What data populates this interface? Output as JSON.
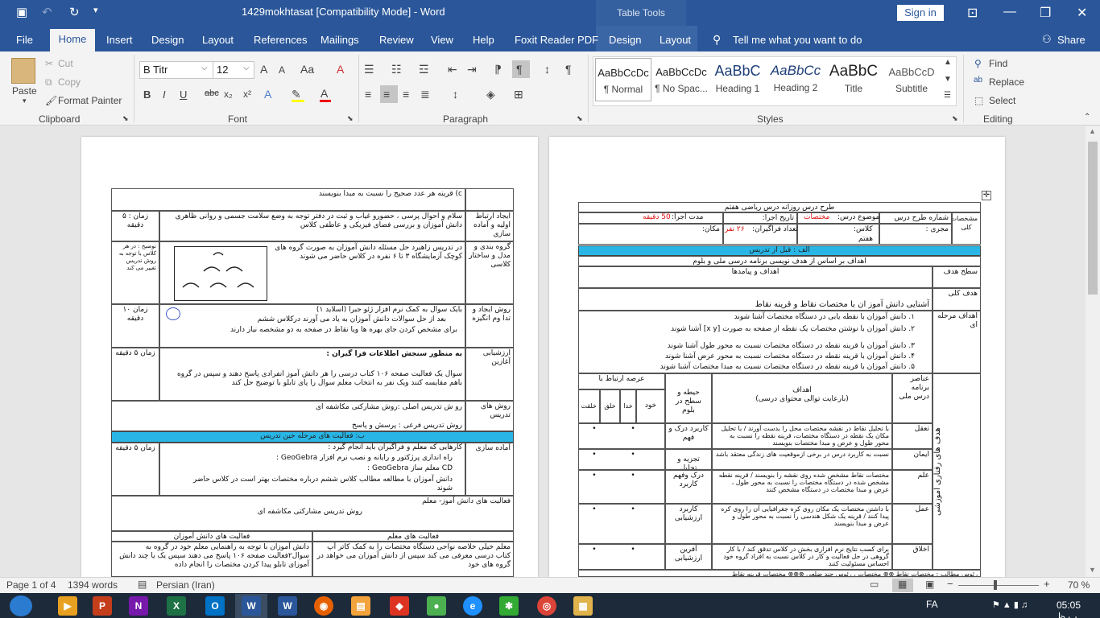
{
  "window": {
    "title": "1429mokhtasat [Compatibility Mode]  -  Word",
    "context_tab_title": "Table Tools",
    "sign_in": "Sign in"
  },
  "tabs": [
    "File",
    "Home",
    "Insert",
    "Design",
    "Layout",
    "References",
    "Mailings",
    "Review",
    "View",
    "Help",
    "Foxit Reader PDF",
    "Design",
    "Layout"
  ],
  "tell_me": "Tell me what you want to do",
  "share": "Share",
  "clipboard": {
    "paste": "Paste",
    "cut": "Cut",
    "copy": "Copy",
    "format_painter": "Format Painter",
    "label": "Clipboard"
  },
  "font": {
    "name": "B Titr",
    "size": "12",
    "label": "Font"
  },
  "paragraph": {
    "label": "Paragraph"
  },
  "styles": {
    "label": "Styles",
    "items": [
      {
        "preview": "AaBbCcDc",
        "name": "¶ Normal"
      },
      {
        "preview": "AaBbCcDc",
        "name": "¶ No Spac..."
      },
      {
        "preview": "AaBbC",
        "name": "Heading 1"
      },
      {
        "preview": "AaBbCc",
        "name": "Heading 2"
      },
      {
        "preview": "AaBbC",
        "name": "Title"
      },
      {
        "preview": "AaBbCcD",
        "name": "Subtitle"
      }
    ]
  },
  "editing": {
    "find": "Find",
    "replace": "Replace",
    "select": "Select",
    "label": "Editing"
  },
  "status": {
    "page": "Page 1 of 4",
    "words": "1394 words",
    "language": "Persian (Iran)",
    "zoom": "70 %"
  },
  "taskbar": {
    "lang": "FA",
    "time": "05:05 ب.ظ"
  },
  "left_page": {
    "r1": "c)   قرینه هر عدد صحیح را نسبت به مبدا بنویسند",
    "r2_h": "ایجاد ارتباط اولیه و آماده سازی",
    "r2_t": "سلام و احوال پرسی ، حضورو غیاب و ثبت در دفتر توجه به  وضع سلامت جسمی و روانی ظاهری دانش آموزان و بررسی فضای فیزیکی و عاطفی کلاس",
    "r2_z": "زمان : ۵ دقیقه",
    "r3_h": "گروه بندی و مدل و ساختار کلاسی",
    "r3_t": "در تدریس زاهبرد حل مسئله دانش آموزان به صورت گروه های کوچک آزمایشگاه ۳ تا ۶ نفره در کلاس حاضر می شوند",
    "r3_z": "توضیح : در هر کلاس با توجه به روش تدریس تغییر می کند",
    "r4_h": "روش ایجاد و تدا وم انگیزه",
    "r4_t1": "بایک سوال به کمک نرم افزار ژئو جبرا (اسلاید ۱)",
    "r4_t2": "بعد از حل سوالات دانش آموزان به یاد می آورند درکلاس ششم",
    "r4_t3": "برای مشخص کردن جای بهره ها ویا نقاط در صفحه به دو مشخصه نیاز دارند",
    "r4_z": "زمان ۱۰ دقیقه",
    "r5_h": "ارزشیابی آغازین",
    "r5_b": "به منظور سنجش اطلاعات فرا گیران :",
    "r5_t": "سوال یک فعالیت صفحه ۱۰۶ کتاب درسی را هر دانش آموز انفرادی پاسخ دهند و سپس در گروه باهم مقایسه کنند ویک نفر به انتخاب معلم سوال را پای تابلو با توضیح حل کند",
    "r5_z": "زمان ۵ دقیقه",
    "r6_h": "روش های تدریس",
    "r6_t1": "رو ش تدریس اصلی :روش مشارکتی مکاشفه ای",
    "r6_t2": "روش تدریس فرعی : پرسش و پاسخ",
    "bar": "ب: فعالیت های مرحله حین تدریس",
    "r7_h": "آماده سازی",
    "r7_t1": "کارهایی که معلم و فراگیران باید انجام گیرد :",
    "r7_t2": "راه اندازی پرژکتور و رایانه و نصب نرم افزار GeoGebra :",
    "r7_t3": "CD معلم ساز GeoGebra :",
    "r7_t4": "دانش آموزان با مطالعه مطالب کلاس ششم درباره مختصات بهتر است در کلاس حاضر شوند",
    "r7_z": "زمان ۵ دقیقه",
    "r8_t1": "فعالیت های دانش آموز- معلم",
    "r8_t2": "روش تدریس مشارکتی مکاشفه ای",
    "h_student": "فعالیت های دانش آموزان",
    "h_teacher": "فعالیت های معلم",
    "c_student": "دانش آموزان با توجه به راهنمایی معلم خود در گروه به سوال۲فعالیت صفحه ۱۰۶ پاسخ می دهند سپس یک یا چند دانش آموزای تابلو پیدا کردن مختصات را انجام داده",
    "c_teacher": "معلم خیلی خلاصه نواحی دستگاه مختصات را به کمک کاتر آپ کتاب درسی معرفی می کند سپس از دانش آموزان می خواهد در گروه های خود"
  },
  "right_page": {
    "title": "طرح درس روزانه  درس ریاضی هفتم",
    "plan_no": "شماره طرح درس",
    "topic": "موضوع درس:",
    "topic_val": "مختصات",
    "date": "تاریخ اجرا:",
    "duration": "مدت اجرا:",
    "duration_val": "50 دقیقه",
    "spec": "مشخصات کلی",
    "executor": "مجری :",
    "class": "کلاس:",
    "class_val": "هفتم",
    "students": "تعداد فراگیران:",
    "students_val": "۲۶ نفر",
    "place": "مکان:",
    "bar_a": "الف : قبل از تدریس",
    "goals_line": "اهداف بر اساس از هدف نویسی برنامه درسی ملی و بلوم",
    "level": "سطح هدف",
    "goals_out": "اهداف و پیامدها",
    "general": "هدف کلی",
    "general_t": "آشنایی دانش آموز ان با مختصات نقاط و قرینه نقاط",
    "stage": "اهداف مرحله ای",
    "g1": "۱.  دانش آموزان با نقطه یابی در دستگاه مختصات آشنا شوند",
    "g2": "۲.  دانش آموزان با نوشتن مختصات یک نقطه از صفحه به صورت [x y] آشنا شوند",
    "g3": "۳.  دانش آموزان با قرینه نقطه در دستگاه مختصات نسبت به محور طول آشنا شوند",
    "g4": "۴.  دانش آموزان با قرینه نقطه در دستگاه مختصات نسبت به محور عرض آشنا شوند",
    "g5": "۵.  دانش آموزان با قرینه نقطه در دستگاه مختصات نسبت به مبدا مختصات  آشنا شوند",
    "elements": "عناصر برنامه درس ملی",
    "objectives": "اهداف",
    "objectives_sub": "(بارعایت توالی محتوای درسی)",
    "bloom": "حیطه و سطح در بلوم",
    "relation": "عرصه ارتباط با",
    "rel_cols": [
      "خود",
      "خدا",
      "خلق",
      "خلقت"
    ],
    "side": "هدف های رفتاری آموزشی",
    "rows": [
      {
        "el": "تعقل",
        "obj": "با تحلیل نقاط در نقشه مختصات محل را بدست آورند / با تحلیل مکان یک نقطه در دستگاه مختصات، قرینه نقطه را نسبت به محور طول و عرض و مبدا مختصات بنویسند",
        "bl": "کاربرد درک و فهم"
      },
      {
        "el": "ایمان",
        "obj": "نسبت به کاربرد درس در برخی ازموقعیت های زندگی معتقد باشد",
        "bl": "تجزیه و تحلیل"
      },
      {
        "el": "علم",
        "obj": "مختصات نقاط مشخص شده روی نقشه را بنویسند / قرینه نقطه مشخص شده در دستگاه مختصات را نسبت به محور طول ، عرض و مبدا مختصات در دستگاه مشخص کنند",
        "bl": "درک وفهم کاربرد"
      },
      {
        "el": "عمل",
        "obj": "با داشتن مختصات یک مکان روی کره جغرافیایی آن را روی کره پیدا کنند / قرینه یک شکل هندسی را نسبت به محور طول و عرض و مبدا بنویسند",
        "bl": "کاربرد ارزشیابی"
      },
      {
        "el": "اخلاق",
        "obj": "برای کسب نتایج نرم افزاری بخش در کلاس تدقق کند / با کار گروهی در حل فعالیت و کار در کلاس نسبت به افراد گروه خود احساس مسئولیت کنند",
        "bl": "آفرین ارزشیابی"
      }
    ],
    "footer": "رئوس مطالب :  مختصات نقاط   ⊗⊗ مختصات ، رئوس جند ضلعی   ⊗⊗⊗ مختصات قرینه نقاط"
  }
}
